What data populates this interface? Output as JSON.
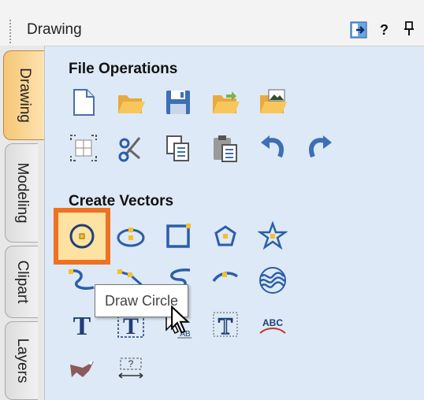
{
  "panel": {
    "title": "Drawing",
    "buttons": {
      "auto_hide": "pin-icon",
      "help": "?",
      "dock": "ф"
    }
  },
  "tabs": [
    {
      "label": "Drawing",
      "active": true
    },
    {
      "label": "Modeling",
      "active": false
    },
    {
      "label": "Clipart",
      "active": false
    },
    {
      "label": "Layers",
      "active": false
    }
  ],
  "sections": {
    "file_operations": {
      "title": "File Operations",
      "icons": [
        "new-file-icon",
        "open-folder-icon",
        "save-icon",
        "open-folder-alt-icon",
        "import-image-folder-icon",
        "fit-view-icon",
        "cut-icon",
        "copy-icon",
        "paste-icon",
        "undo-icon",
        "redo-icon"
      ]
    },
    "create_vectors": {
      "title": "Create Vectors",
      "icons": [
        "draw-circle-icon",
        "draw-ellipse-icon",
        "draw-rectangle-icon",
        "draw-polygon-icon",
        "draw-star-icon",
        "draw-polyline-icon",
        "draw-curve-icon",
        "draw-spline-icon",
        "draw-arc-icon",
        "wave-pattern-icon",
        "text-icon",
        "text-box-icon",
        "text-on-selection-icon",
        "text-adjust-icon",
        "text-on-curve-icon",
        "bitmap-trace-icon",
        "dimension-icon"
      ]
    }
  },
  "tooltip": {
    "text": "Draw Circle"
  },
  "colors": {
    "content_bg": "#dde9f6",
    "highlight_border": "#ee7221",
    "highlight_fill": "#fde2a2",
    "active_tab": "#f6c676",
    "icon_blue": "#2b5ea8"
  }
}
